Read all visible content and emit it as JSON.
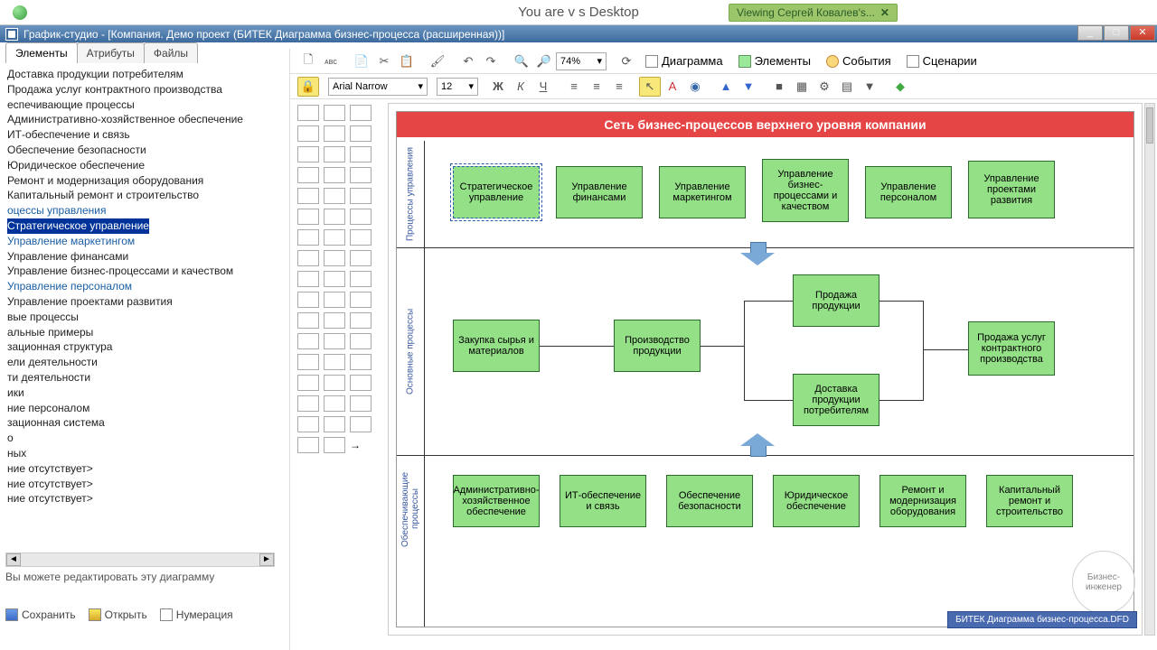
{
  "desktop_text": "You are v                                               s Desktop",
  "viewing_badge": "Viewing Сергей Ковалев's...",
  "title": "График-студио - [Компания. Демо проект (БИТЕК Диаграмма бизнес-процесса (расширенная))]",
  "tabs": {
    "elements": "Элементы",
    "attributes": "Атрибуты",
    "files": "Файлы"
  },
  "tree": [
    {
      "t": "Доставка продукции потребителям",
      "c": "n"
    },
    {
      "t": "Продажа услуг контрактного производства",
      "c": "n"
    },
    {
      "t": "еспечивающие процессы",
      "c": "n"
    },
    {
      "t": "Административно-хозяйственное обеспечение",
      "c": "n"
    },
    {
      "t": "ИТ-обеспечение и связь",
      "c": "n"
    },
    {
      "t": "Обеспечение безопасности",
      "c": "n"
    },
    {
      "t": "Юридическое обеспечение",
      "c": "n"
    },
    {
      "t": "Ремонт и модернизация оборудования",
      "c": "n"
    },
    {
      "t": "Капитальный ремонт и строительство",
      "c": "n"
    },
    {
      "t": "оцессы управления",
      "c": "l"
    },
    {
      "t": "Стратегическое управление",
      "c": "s"
    },
    {
      "t": "Управление маркетингом",
      "c": "l"
    },
    {
      "t": "Управление финансами",
      "c": "n"
    },
    {
      "t": "Управление бизнес-процессами и качеством",
      "c": "n"
    },
    {
      "t": "Управление персоналом",
      "c": "l"
    },
    {
      "t": "Управление проектами развития",
      "c": "n"
    },
    {
      "t": "",
      "c": "n"
    },
    {
      "t": "вые процессы",
      "c": "n"
    },
    {
      "t": "альные примеры",
      "c": "n"
    },
    {
      "t": "зационная структура",
      "c": "n"
    },
    {
      "t": "ели деятельности",
      "c": "n"
    },
    {
      "t": "ти деятельности",
      "c": "n"
    },
    {
      "t": "ики",
      "c": "n"
    },
    {
      "t": "ние персоналом",
      "c": "n"
    },
    {
      "t": "зационная система",
      "c": "n"
    },
    {
      "t": "о",
      "c": "n"
    },
    {
      "t": "",
      "c": "n"
    },
    {
      "t": "ных",
      "c": "n"
    },
    {
      "t": "ние отсутствует>",
      "c": "n"
    },
    {
      "t": "ние отсутствует>",
      "c": "n"
    },
    {
      "t": "ние отсутствует>",
      "c": "n"
    }
  ],
  "status": "Вы можете редактировать эту диаграмму",
  "buttons": {
    "save": "Сохранить",
    "open": "Открыть",
    "number": "Нумерация"
  },
  "toolbar": {
    "zoom": "74%",
    "diagram": "Диаграмма",
    "elements": "Элементы",
    "events": "События",
    "scenarios": "Сценарии",
    "font": "Arial Narrow",
    "fontsize": "12"
  },
  "diagram": {
    "title": "Сеть бизнес-процессов верхнего уровня компании",
    "row_labels": [
      "Процессы управления",
      "Основные процессы",
      "Обеспечивающие процессы"
    ],
    "row1": [
      "Стратегическое управление",
      "Управление финансами",
      "Управление маркетингом",
      "Управление бизнес-процессами и качеством",
      "Управление персоналом",
      "Управление проектами развития"
    ],
    "row2": [
      "Закупка сырья и материалов",
      "Производство продукции",
      "Продажа продукции",
      "Доставка продукции потребителям",
      "Продажа услуг контрактного производства"
    ],
    "row3": [
      "Административно-хозяйственное обеспечение",
      "ИТ-обеспечение и связь",
      "Обеспечение безопасности",
      "Юридическое обеспечение",
      "Ремонт и модернизация оборудования",
      "Капитальный ремонт и строительство"
    ]
  },
  "footer_badge": "БИТЕК Диаграмма бизнес-процесса.DFD",
  "watermark": "Бизнес-инженер"
}
